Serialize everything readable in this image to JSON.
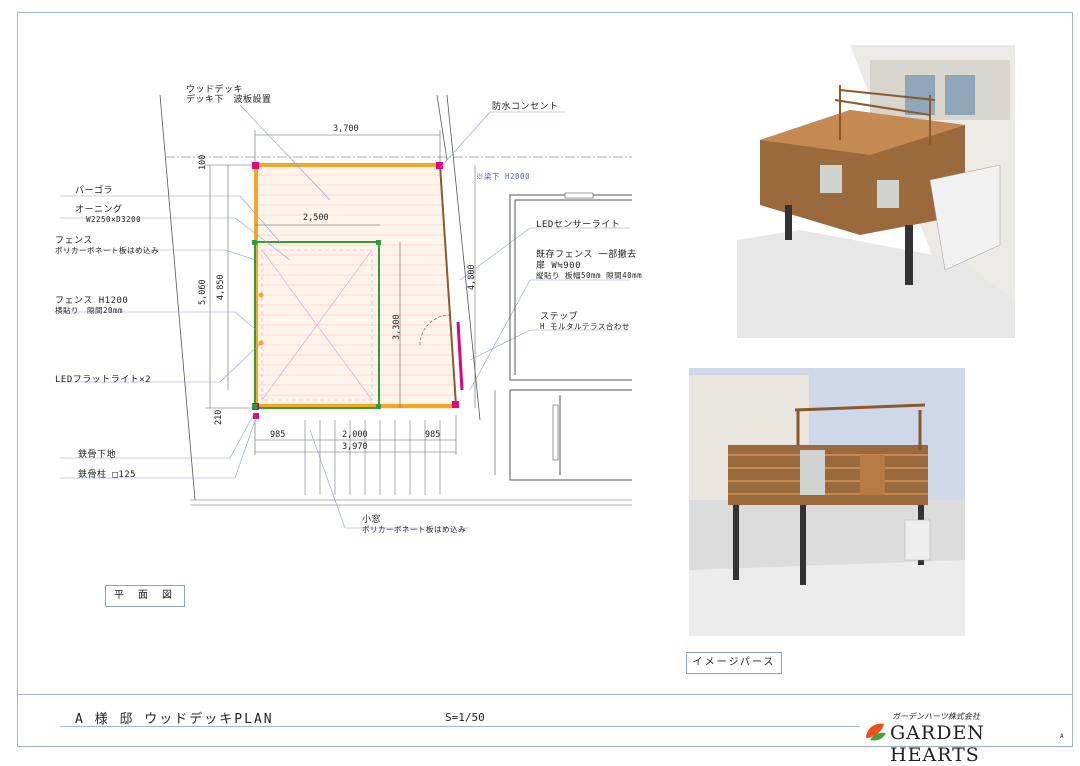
{
  "labels": {
    "wood_deck": "ウッドデッキ",
    "wood_deck_sub": "デッキ下　波板設置",
    "waterproof_outlet": "防水コンセント",
    "beam_note": "※梁下 H2000",
    "pergola": "パーゴラ",
    "awning": "オーニング",
    "awning_size": "W2250×D3200",
    "fence": "フェンス",
    "fence_sub": "ポリカーボネート板はめ込み",
    "fence_h": "フェンス H1200",
    "fence_h_sub": "横貼り　隙間20mm",
    "led_flat": "LEDフラットライト×2",
    "steel_base": "鉄骨下地",
    "steel_post": "鉄骨柱 □125",
    "led_sensor": "LEDセンサーライト",
    "existing_fence": "既存フェンス 一部撤去",
    "gate": "扉 W≒900",
    "existing_fence_sub": "縦貼り 板幅50mm 隙間40mm",
    "step": "ステップ",
    "step_sub": "H モルタルテラス合わせ",
    "small_window": "小窓",
    "small_window_sub": "ポリカーボネート板はめ込み"
  },
  "dims": {
    "w_top": "3,700",
    "w_inner": "2,500",
    "d_left": "5,060",
    "d_left2": "4,850",
    "d_right": "4,800",
    "d_mid": "3,300",
    "top_100": "100",
    "bot_210": "210",
    "b_left": "985",
    "b_mid": "2,000",
    "b_right": "985",
    "b_total": "3,970"
  },
  "titles": {
    "plan": "平 面 図",
    "perspective": "イメージパース",
    "drawing_title": "A 様 邸 ウッドデッキPLAN",
    "scale": "S=1/50",
    "company": "ガーデンハーツ株式会社",
    "brand": "GARDEN HEARTS",
    "rev": "A"
  },
  "colors": {
    "frame": "#9db4d3",
    "deck_orange": "#f5a623",
    "pergola_green": "#2e9e3a",
    "post_magenta": "#e6007e",
    "wood": "#8b5a2b"
  }
}
